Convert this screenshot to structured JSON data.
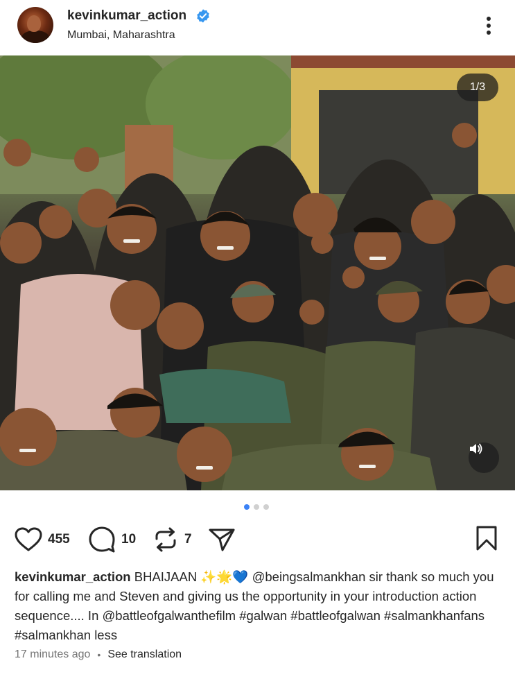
{
  "header": {
    "username": "kevinkumar_action",
    "verified": true,
    "location": "Mumbai, Maharashtra",
    "more_icon": "more-vertical-icon"
  },
  "media": {
    "counter": "1/3",
    "audio_icon": "speaker-icon",
    "carousel_total": 3,
    "carousel_active": 1
  },
  "actions": {
    "likes": "455",
    "comments": "10",
    "reposts": "7",
    "like_icon": "heart-icon",
    "comment_icon": "comment-bubble-icon",
    "repost_icon": "repost-icon",
    "share_icon": "send-icon",
    "save_icon": "bookmark-icon"
  },
  "caption": {
    "username": "kevinkumar_action",
    "text_1": "BHAIJAAN ✨🌟💙 ",
    "mention_1": "@beingsalmankhan",
    "text_2": " sir thank so much you for calling me and Steven and giving us the opportunity in your introduction action sequence.... In ",
    "mention_2": "@battleofgalwanthefilm",
    "text_3": " ",
    "hashtags": "#galwan #battleofgalwan #salmankhanfans #salmankhan",
    "more_label": "less"
  },
  "meta": {
    "time": "17 minutes ago",
    "separator": "•",
    "translate": "See translation"
  },
  "colors": {
    "verified_badge": "#3797f0",
    "active_dot": "#3b82f6",
    "inactive_dot": "#d0d0d0",
    "text": "#262626",
    "secondary": "#737373"
  }
}
